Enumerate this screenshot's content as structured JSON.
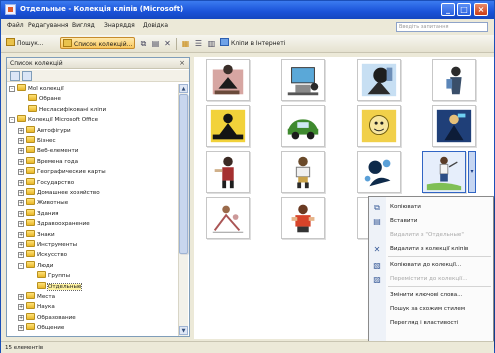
{
  "window": {
    "title": "Отдельные - Колекція кліпів (Microsoft)"
  },
  "menu": {
    "items": [
      "Файл",
      "Редагування",
      "Вигляд",
      "Знаряддя",
      "Довідка"
    ]
  },
  "search": {
    "placeholder": "Введіть запитання"
  },
  "toolbar": {
    "search_label": "Пошук...",
    "collections_label": "Список колекцій...",
    "clips_online_label": "Кліпи в Інтернеті"
  },
  "pane": {
    "title": "Список колекцій",
    "tree": [
      {
        "label": "Мої колекції",
        "level": 1,
        "expander": "-"
      },
      {
        "label": "Обране",
        "level": 2,
        "expander": ""
      },
      {
        "label": "Несласифіковані кліпи",
        "level": 2,
        "expander": ""
      },
      {
        "label": "Колекції Microsoft Office",
        "level": 1,
        "expander": "-"
      },
      {
        "label": "Автофігури",
        "level": 2,
        "expander": "+"
      },
      {
        "label": "Бізнес",
        "level": 2,
        "expander": "+"
      },
      {
        "label": "Веб-елементи",
        "level": 2,
        "expander": "+"
      },
      {
        "label": "Времена года",
        "level": 2,
        "expander": "+"
      },
      {
        "label": "Географические карты",
        "level": 2,
        "expander": "+"
      },
      {
        "label": "Государство",
        "level": 2,
        "expander": "+"
      },
      {
        "label": "Домашнее хозяйство",
        "level": 2,
        "expander": "+"
      },
      {
        "label": "Животные",
        "level": 2,
        "expander": "+"
      },
      {
        "label": "Здания",
        "level": 2,
        "expander": "+"
      },
      {
        "label": "Здравоохранение",
        "level": 2,
        "expander": "+"
      },
      {
        "label": "Знаки",
        "level": 2,
        "expander": "+"
      },
      {
        "label": "Инструменты",
        "level": 2,
        "expander": "+"
      },
      {
        "label": "Искусство",
        "level": 2,
        "expander": "+"
      },
      {
        "label": "Люди",
        "level": 2,
        "expander": "-"
      },
      {
        "label": "Группы",
        "level": 3,
        "expander": ""
      },
      {
        "label": "Отдельные",
        "level": 3,
        "expander": "",
        "selected": true
      },
      {
        "label": "Места",
        "level": 2,
        "expander": "+"
      },
      {
        "label": "Наука",
        "level": 2,
        "expander": "+"
      },
      {
        "label": "Образование",
        "level": 2,
        "expander": "+"
      },
      {
        "label": "Общение",
        "level": 2,
        "expander": "+"
      }
    ]
  },
  "context_menu": {
    "items": [
      {
        "label": "Копіювати",
        "icon": "copy-icon",
        "disabled": false
      },
      {
        "label": "Вставити",
        "icon": "paste-icon",
        "disabled": false
      },
      {
        "label": "Видалити з \"Отдельные\"",
        "icon": "",
        "disabled": true
      },
      {
        "label": "Видалити з колекції кліпів",
        "icon": "delete-icon",
        "disabled": false
      },
      {
        "label": "Копіювати до колекції...",
        "icon": "copy-to-collection-icon",
        "disabled": false
      },
      {
        "label": "Перемістити до колекції...",
        "icon": "move-to-collection-icon",
        "disabled": true
      },
      {
        "label": "Змінити ключові слова...",
        "icon": "",
        "disabled": false
      },
      {
        "label": "Пошук за схожим стилем",
        "icon": "",
        "disabled": false
      },
      {
        "label": "Перегляд і властивості",
        "icon": "",
        "disabled": false
      }
    ]
  },
  "status": {
    "text": "15 елементів"
  },
  "colors": {
    "title_bar": "#1a52d8",
    "selection": "#3165c4",
    "folder": "#e9b82a"
  }
}
